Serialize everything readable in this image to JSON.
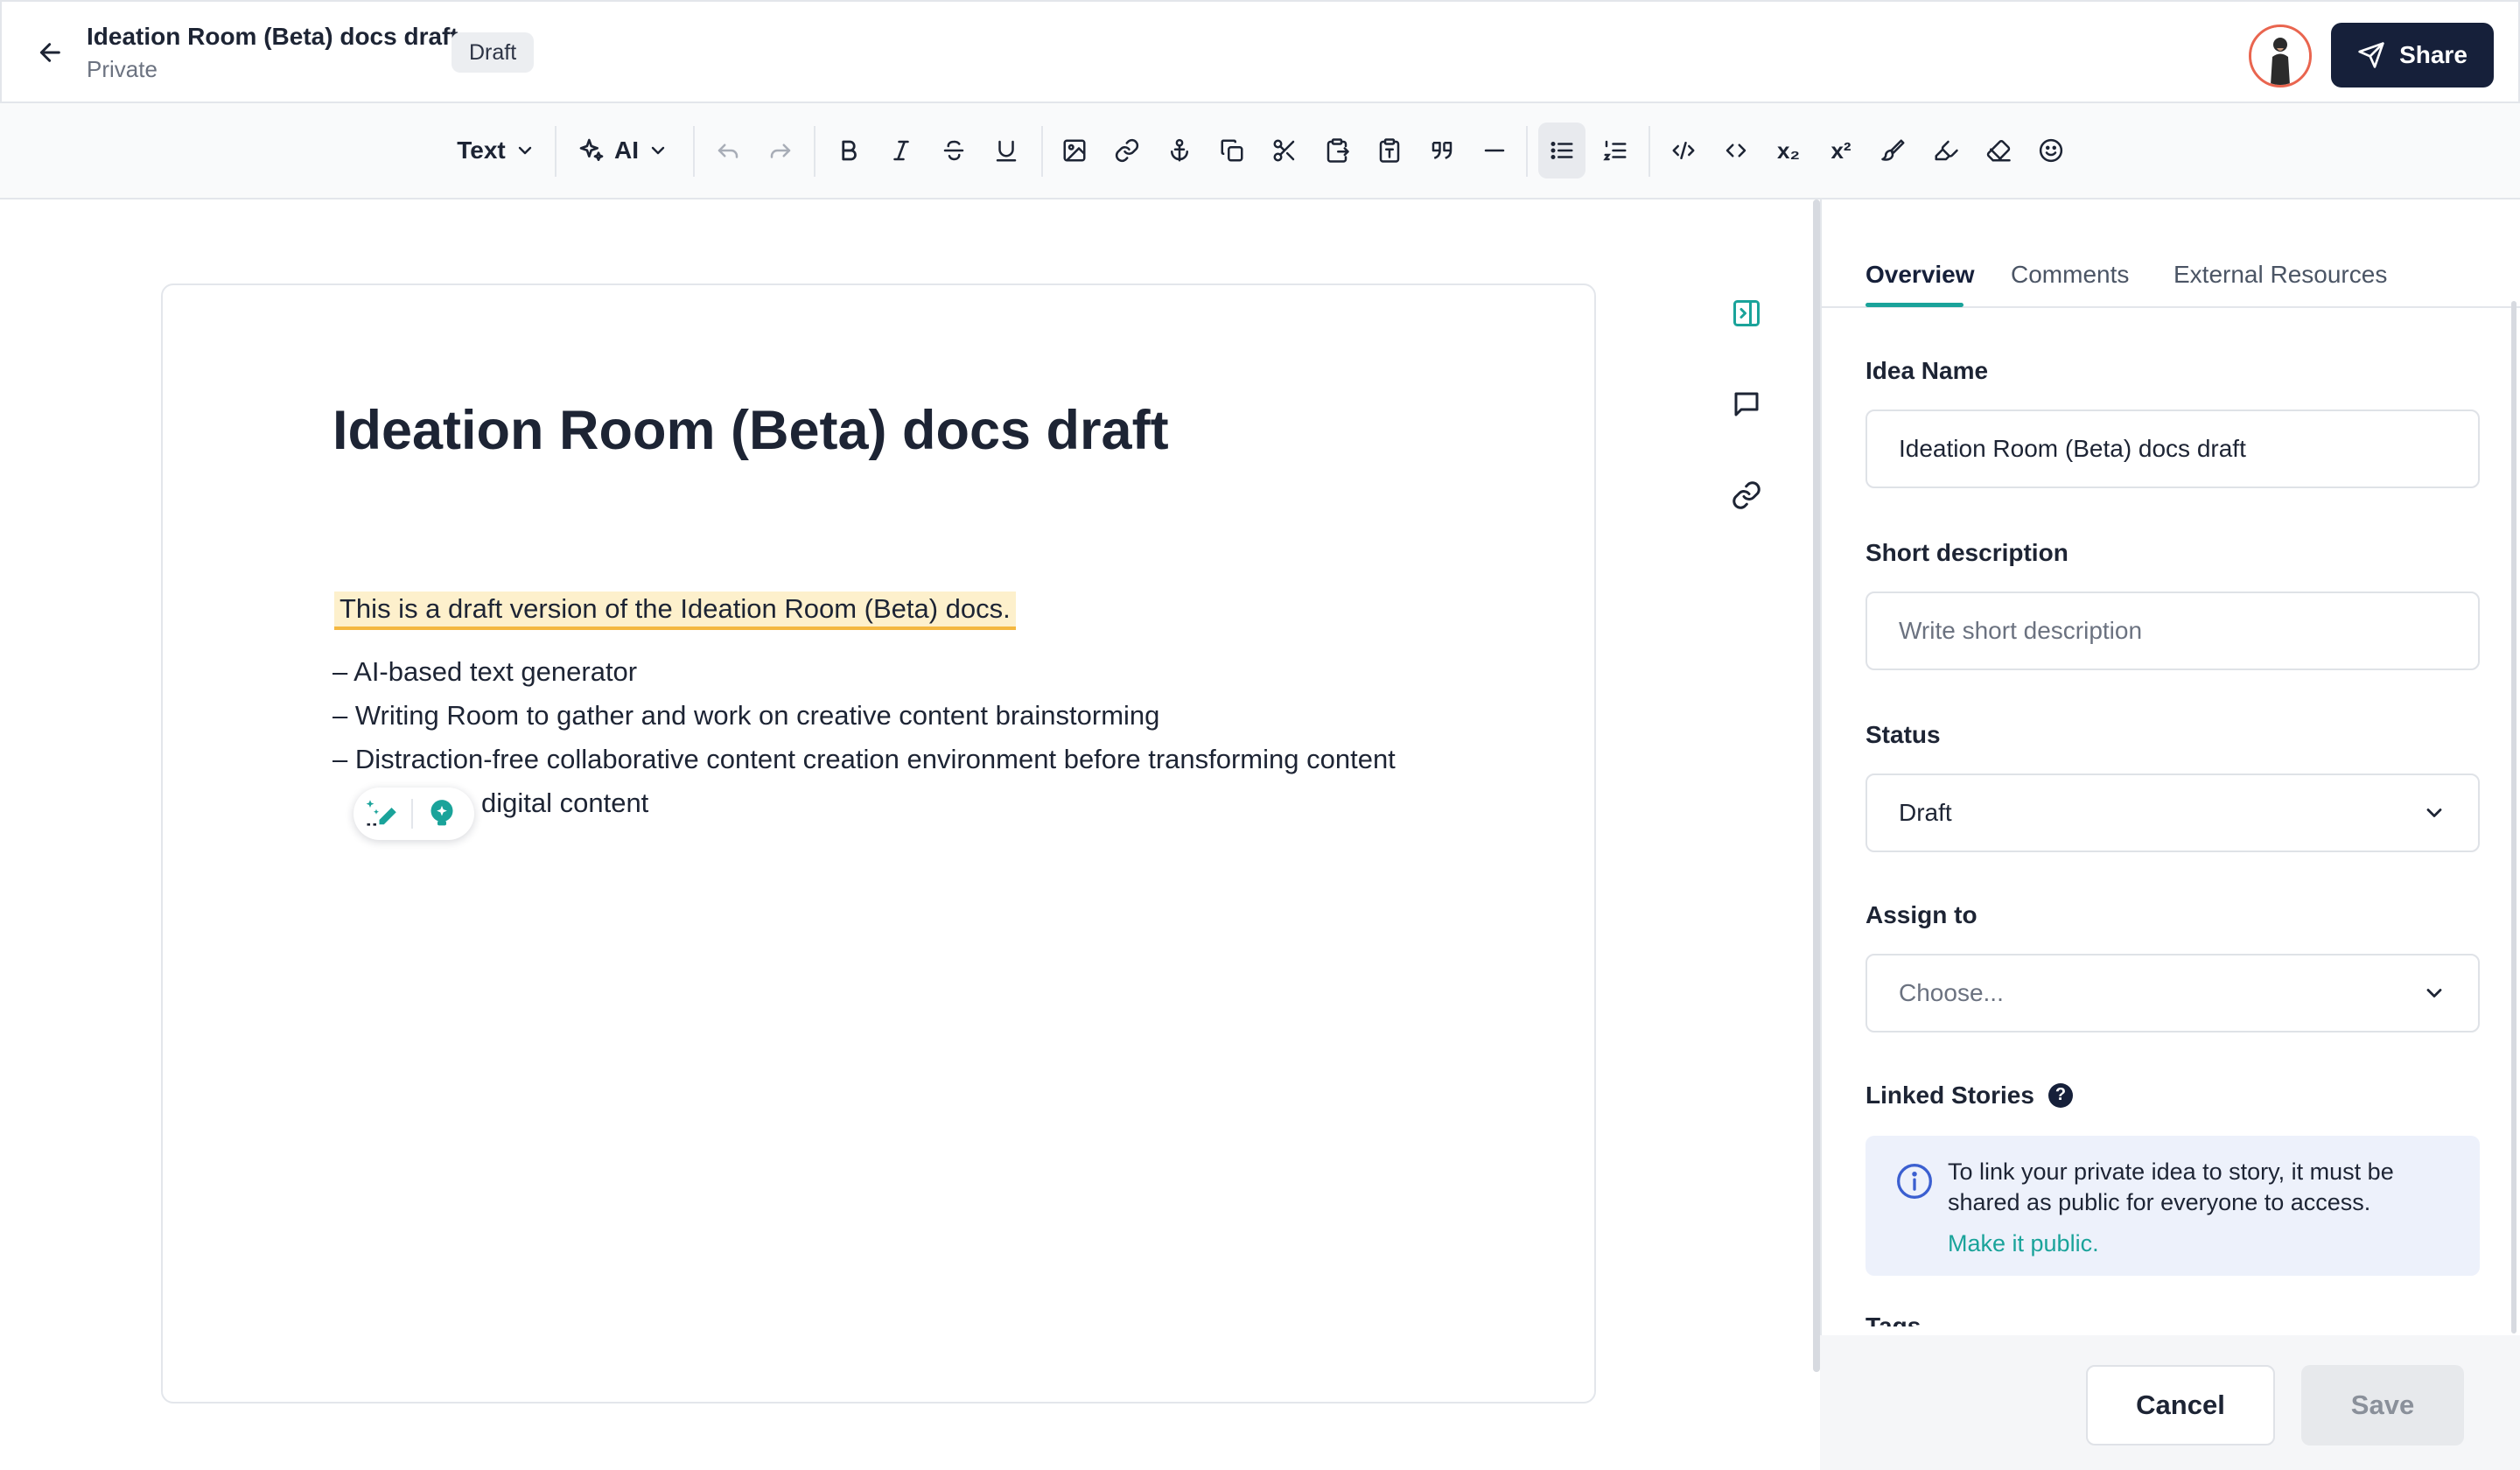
{
  "header": {
    "title": "Ideation Room (Beta) docs draft",
    "subtitle": "Private",
    "badge": "Draft",
    "share_label": "Share"
  },
  "toolbar": {
    "text_style_label": "Text",
    "ai_label": "AI",
    "items": [
      "undo-icon",
      "redo-icon",
      "bold-icon",
      "italic-icon",
      "strikethrough-icon",
      "underline-icon",
      "image-icon",
      "link-icon",
      "anchor-icon",
      "copy-icon",
      "cut-icon",
      "paste-icon",
      "paste-text-icon",
      "quote-icon",
      "horizontal-rule-icon",
      "bullet-list-icon",
      "numbered-list-icon",
      "code-block-icon",
      "inline-code-icon",
      "subscript-icon",
      "superscript-icon",
      "brush-icon",
      "highlighter-icon",
      "eraser-icon",
      "emoji-icon"
    ],
    "subscript_glyph": "x₂",
    "superscript_glyph": "x²"
  },
  "editor": {
    "heading": "Ideation Room (Beta) docs draft",
    "highlight": "This is a draft version of the Ideation Room (Beta) docs.",
    "bullets": [
      "– AI-based text generator",
      "– Writing Room to gather and work on creative content brainstorming",
      "– Distraction-free collaborative content creation environment before transforming content",
      "digital content"
    ]
  },
  "panel": {
    "tabs": [
      "Overview",
      "Comments",
      "External Resources"
    ],
    "active_tab": "Overview",
    "idea_name_label": "Idea Name",
    "idea_name_value": "Ideation Room (Beta) docs draft",
    "short_desc_label": "Short description",
    "short_desc_placeholder": "Write short description",
    "status_label": "Status",
    "status_value": "Draft",
    "assign_label": "Assign to",
    "assign_placeholder": "Choose...",
    "linked_label": "Linked Stories",
    "linked_help": "?",
    "info_text": "To link your private idea to story, it must be shared as public for everyone to access.",
    "info_link": "Make it public.",
    "tags_label": "Tags",
    "cancel_label": "Cancel",
    "save_label": "Save"
  },
  "colors": {
    "accent": "#1aa39a",
    "primary_button": "#16203a",
    "highlight_bg": "#fdf0cc",
    "highlight_underline": "#f4b740",
    "info_bg": "#edf1fb",
    "avatar_ring": "#e9654f"
  }
}
